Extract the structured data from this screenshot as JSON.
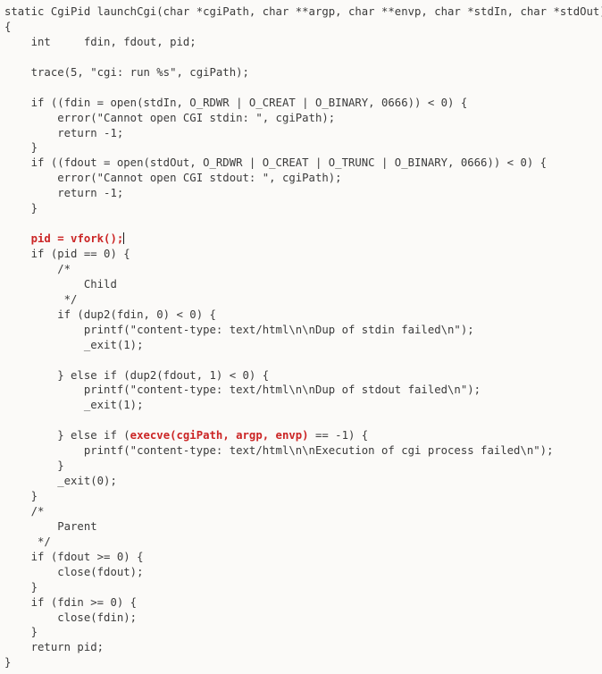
{
  "editor": {
    "background_color": "#fbfaf8",
    "text_color": "#3b3b3b",
    "highlight_color": "#cb2525",
    "caret_color": "#1a1a1a",
    "font_size_px": 12,
    "line_height_px": 17,
    "language": "C"
  },
  "code": {
    "lines": [
      {
        "id": 1,
        "segments": [
          {
            "text": "static CgiPid launchCgi(char *cgiPath, char **argp, char **envp, char *stdIn, char *stdOut)",
            "style": "plain"
          }
        ]
      },
      {
        "id": 2,
        "segments": [
          {
            "text": "{",
            "style": "plain"
          }
        ]
      },
      {
        "id": 3,
        "segments": [
          {
            "text": "    int     fdin, fdout, pid;",
            "style": "plain"
          }
        ]
      },
      {
        "id": 4,
        "segments": [
          {
            "text": "",
            "style": "plain"
          }
        ]
      },
      {
        "id": 5,
        "segments": [
          {
            "text": "    trace(5, \"cgi: run %s\", cgiPath);",
            "style": "plain"
          }
        ]
      },
      {
        "id": 6,
        "segments": [
          {
            "text": "",
            "style": "plain"
          }
        ]
      },
      {
        "id": 7,
        "segments": [
          {
            "text": "    if ((fdin = open(stdIn, O_RDWR | O_CREAT | O_BINARY, 0666)) < 0) {",
            "style": "plain"
          }
        ]
      },
      {
        "id": 8,
        "segments": [
          {
            "text": "        error(\"Cannot open CGI stdin: \", cgiPath);",
            "style": "plain"
          }
        ]
      },
      {
        "id": 9,
        "segments": [
          {
            "text": "        return -1;",
            "style": "plain"
          }
        ]
      },
      {
        "id": 10,
        "segments": [
          {
            "text": "    }",
            "style": "plain"
          }
        ]
      },
      {
        "id": 11,
        "segments": [
          {
            "text": "    if ((fdout = open(stdOut, O_RDWR | O_CREAT | O_TRUNC | O_BINARY, 0666)) < 0) {",
            "style": "plain"
          }
        ]
      },
      {
        "id": 12,
        "segments": [
          {
            "text": "        error(\"Cannot open CGI stdout: \", cgiPath);",
            "style": "plain"
          }
        ]
      },
      {
        "id": 13,
        "segments": [
          {
            "text": "        return -1;",
            "style": "plain"
          }
        ]
      },
      {
        "id": 14,
        "segments": [
          {
            "text": "    }",
            "style": "plain"
          }
        ]
      },
      {
        "id": 15,
        "segments": [
          {
            "text": "",
            "style": "plain"
          }
        ]
      },
      {
        "id": 16,
        "segments": [
          {
            "text": "    ",
            "style": "plain"
          },
          {
            "text": "pid = vfork();",
            "style": "hl"
          },
          {
            "text": "",
            "style": "caret"
          }
        ]
      },
      {
        "id": 17,
        "segments": [
          {
            "text": "    if (pid == 0) {",
            "style": "plain"
          }
        ]
      },
      {
        "id": 18,
        "segments": [
          {
            "text": "        /*",
            "style": "plain"
          }
        ]
      },
      {
        "id": 19,
        "segments": [
          {
            "text": "            Child",
            "style": "plain"
          }
        ]
      },
      {
        "id": 20,
        "segments": [
          {
            "text": "         */",
            "style": "plain"
          }
        ]
      },
      {
        "id": 21,
        "segments": [
          {
            "text": "        if (dup2(fdin, 0) < 0) {",
            "style": "plain"
          }
        ]
      },
      {
        "id": 22,
        "segments": [
          {
            "text": "            printf(\"content-type: text/html\\n\\nDup of stdin failed\\n\");",
            "style": "plain"
          }
        ]
      },
      {
        "id": 23,
        "segments": [
          {
            "text": "            _exit(1);",
            "style": "plain"
          }
        ]
      },
      {
        "id": 24,
        "segments": [
          {
            "text": "",
            "style": "plain"
          }
        ]
      },
      {
        "id": 25,
        "segments": [
          {
            "text": "        } else if (dup2(fdout, 1) < 0) {",
            "style": "plain"
          }
        ]
      },
      {
        "id": 26,
        "segments": [
          {
            "text": "            printf(\"content-type: text/html\\n\\nDup of stdout failed\\n\");",
            "style": "plain"
          }
        ]
      },
      {
        "id": 27,
        "segments": [
          {
            "text": "            _exit(1);",
            "style": "plain"
          }
        ]
      },
      {
        "id": 28,
        "segments": [
          {
            "text": "",
            "style": "plain"
          }
        ]
      },
      {
        "id": 29,
        "segments": [
          {
            "text": "        } else if (",
            "style": "plain"
          },
          {
            "text": "execve(cgiPath, argp, envp)",
            "style": "hl"
          },
          {
            "text": " == -1) {",
            "style": "plain"
          }
        ]
      },
      {
        "id": 30,
        "segments": [
          {
            "text": "            printf(\"content-type: text/html\\n\\nExecution of cgi process failed\\n\");",
            "style": "plain"
          }
        ]
      },
      {
        "id": 31,
        "segments": [
          {
            "text": "        }",
            "style": "plain"
          }
        ]
      },
      {
        "id": 32,
        "segments": [
          {
            "text": "        _exit(0);",
            "style": "plain"
          }
        ]
      },
      {
        "id": 33,
        "segments": [
          {
            "text": "    }",
            "style": "plain"
          }
        ]
      },
      {
        "id": 34,
        "segments": [
          {
            "text": "    /*",
            "style": "plain"
          }
        ]
      },
      {
        "id": 35,
        "segments": [
          {
            "text": "        Parent",
            "style": "plain"
          }
        ]
      },
      {
        "id": 36,
        "segments": [
          {
            "text": "     */",
            "style": "plain"
          }
        ]
      },
      {
        "id": 37,
        "segments": [
          {
            "text": "    if (fdout >= 0) {",
            "style": "plain"
          }
        ]
      },
      {
        "id": 38,
        "segments": [
          {
            "text": "        close(fdout);",
            "style": "plain"
          }
        ]
      },
      {
        "id": 39,
        "segments": [
          {
            "text": "    }",
            "style": "plain"
          }
        ]
      },
      {
        "id": 40,
        "segments": [
          {
            "text": "    if (fdin >= 0) {",
            "style": "plain"
          }
        ]
      },
      {
        "id": 41,
        "segments": [
          {
            "text": "        close(fdin);",
            "style": "plain"
          }
        ]
      },
      {
        "id": 42,
        "segments": [
          {
            "text": "    }",
            "style": "plain"
          }
        ]
      },
      {
        "id": 43,
        "segments": [
          {
            "text": "    return pid;",
            "style": "plain"
          }
        ]
      },
      {
        "id": 44,
        "segments": [
          {
            "text": "}",
            "style": "plain"
          }
        ]
      }
    ]
  }
}
